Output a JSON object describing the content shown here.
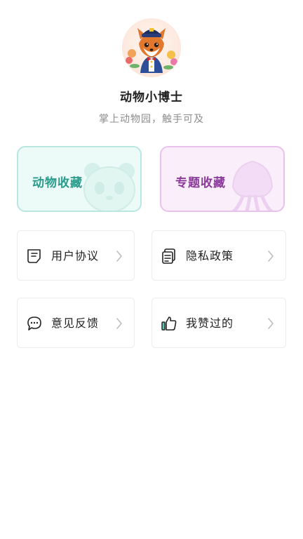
{
  "profile": {
    "title": "动物小博士",
    "subtitle": "掌上动物园，触手可及",
    "avatar_icon": "fox-captain-avatar"
  },
  "collections": [
    {
      "label": "动物收藏",
      "icon": "panda-icon",
      "color": "#2a9a8a"
    },
    {
      "label": "专题收藏",
      "icon": "squid-icon",
      "color": "#8a3a98"
    }
  ],
  "menu": [
    {
      "label": "用户协议",
      "icon": "document-list-icon"
    },
    {
      "label": "隐私政策",
      "icon": "document-stack-icon"
    },
    {
      "label": "意见反馈",
      "icon": "chat-bubble-icon"
    },
    {
      "label": "我赞过的",
      "icon": "thumbs-up-icon"
    }
  ]
}
